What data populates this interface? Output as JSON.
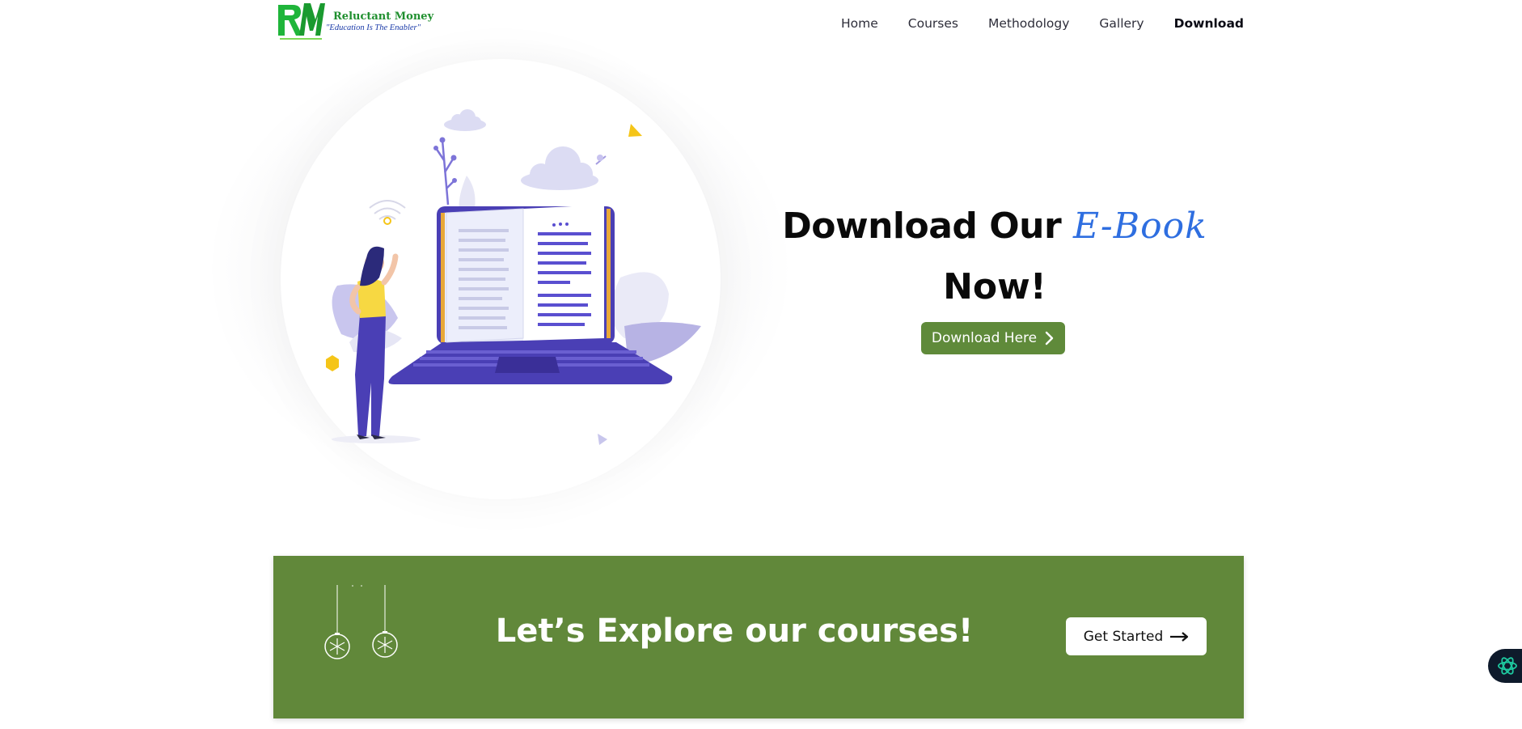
{
  "brand": {
    "name": "Reluctant Money",
    "tagline": "\"Education Is The Enabler\"",
    "logo_initials": "RM"
  },
  "nav": {
    "items": [
      {
        "label": "Home",
        "active": false
      },
      {
        "label": "Courses",
        "active": false
      },
      {
        "label": "Methodology",
        "active": false
      },
      {
        "label": "Gallery",
        "active": false
      },
      {
        "label": "Download",
        "active": true
      }
    ]
  },
  "hero": {
    "title_prefix": "Download Our",
    "title_accent": "E-Book",
    "title_suffix": "Now!",
    "button_label": "Download Here",
    "button_icon": "chevron-right-icon"
  },
  "banner": {
    "title": "Let’s Explore our courses!",
    "button_label": "Get Started",
    "button_icon": "arrow-right-icon"
  },
  "colors": {
    "brand_green": "#61883a",
    "accent_blue": "#2e6ee0",
    "illustration_purple": "#4a3fb5",
    "logo_green": "#1fb53a"
  }
}
